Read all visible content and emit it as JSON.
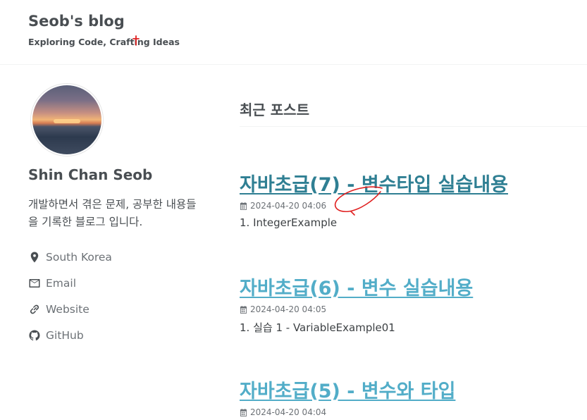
{
  "header": {
    "site_title": "Seob's blog",
    "site_subtitle": "Exploring Code, Crafting Ideas"
  },
  "author": {
    "name": "Shin Chan Seob",
    "bio": "개발하면서 겪은 문제, 공부한 내용들을 기록한 블로그 입니다.",
    "links": [
      {
        "label": "South Korea",
        "icon": "map-marker-icon"
      },
      {
        "label": "Email",
        "icon": "envelope-icon"
      },
      {
        "label": "Website",
        "icon": "link-icon"
      },
      {
        "label": "GitHub",
        "icon": "github-icon"
      }
    ]
  },
  "main": {
    "section_title": "최근 포스트",
    "posts": [
      {
        "title": "자바초급(7) - 변수타입 실습내용",
        "date": "2024-04-20 04:06",
        "excerpt": "1. IntegerExample"
      },
      {
        "title": "자바초급(6) - 변수 실습내용",
        "date": "2024-04-20 04:05",
        "excerpt": "1. 실습 1 - VariableExample01"
      },
      {
        "title": "자바초급(5) - 변수와 타입",
        "date": "2024-04-20 04:04",
        "excerpt": ""
      }
    ]
  },
  "colors": {
    "link_visited": "#2f7f93",
    "link": "#52adc8",
    "text": "#494e52",
    "annotation": "#e02020"
  }
}
